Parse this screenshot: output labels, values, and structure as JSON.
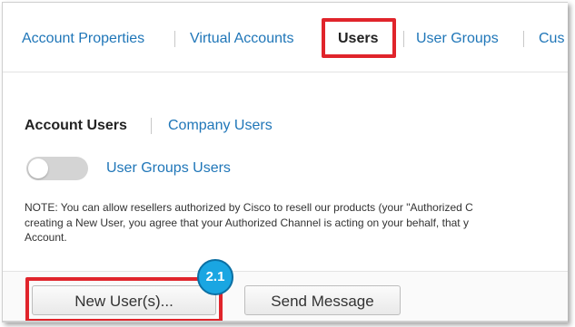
{
  "topnav": {
    "tabs": [
      {
        "label": "Account Properties"
      },
      {
        "label": "Virtual Accounts"
      },
      {
        "label": "Users",
        "active": true
      },
      {
        "label": "User Groups"
      },
      {
        "label": "Cus"
      }
    ]
  },
  "subnav": {
    "account_users": "Account Users",
    "company_users": "Company Users"
  },
  "toggle": {
    "label": "User Groups Users",
    "on": false
  },
  "note": {
    "line1": "NOTE: You can allow resellers authorized by Cisco to resell our products (your \"Authorized C",
    "line2": "creating a New User, you agree that your Authorized Channel is acting on your behalf, that y",
    "line3": "Account."
  },
  "actions": {
    "new_users": "New User(s)...",
    "send_message": "Send Message"
  },
  "annotation": {
    "step": "2.1"
  },
  "colors": {
    "link": "#1f76b8",
    "highlight": "#e0242b",
    "badge": "#1aa6e2"
  }
}
